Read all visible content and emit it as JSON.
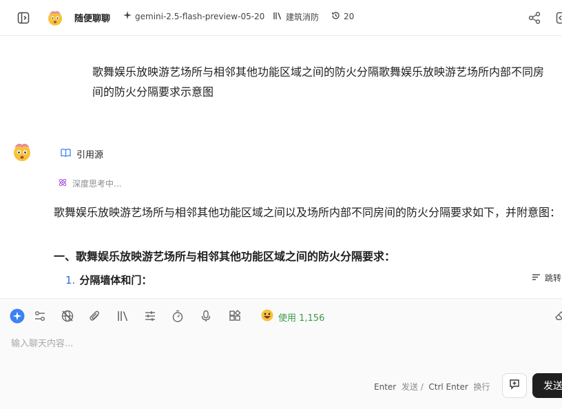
{
  "header": {
    "app_title": "随便聊聊",
    "model": "gemini-2.5-flash-preview-05-20",
    "knowledge_base": "建筑消防",
    "history_count": "20",
    "icons": [
      "sidebar-toggle-icon",
      "sparkle-icon",
      "library-icon",
      "history-icon",
      "share-icon",
      "export-icon"
    ]
  },
  "conversation": {
    "user_message": "歌舞娱乐放映游艺场所与相邻其他功能区域之间的防火分隔歌舞娱乐放映游艺场所内部不同房间的防火分隔要求示意图",
    "assistant": {
      "citation_label": "引用源",
      "thinking_label": "深度思考中...",
      "answer_intro": "歌舞娱乐放映游艺场所与相邻其他功能区域之间以及场所内部不同房间的防火分隔要求如下，并附意图：",
      "section_heading": "一、歌舞娱乐放映游艺场所与相邻其他功能区域之间的防火分隔要求：",
      "list_item_number": "1.",
      "list_item_text": "分隔墙体和门：",
      "jump_label": "跳转"
    }
  },
  "composer": {
    "usage_label": "使用 1,156",
    "placeholder": "输入聊天内容...",
    "hint_enter": "Enter",
    "hint_send": "发送",
    "hint_sep": "/",
    "hint_ctrl_enter": "Ctrl  Enter",
    "hint_newline": "换行",
    "send_label": "发送",
    "tool_icons": [
      "sparkle-mode-icon",
      "settings-sliders-icon",
      "web-off-icon",
      "attachment-icon",
      "library-icon",
      "tune-icon",
      "timer-icon",
      "microphone-icon",
      "apps-icon"
    ]
  },
  "colors": {
    "accent_blue": "#3b82f6",
    "usage_green": "#3a9a4a",
    "send_bg": "#1f1f1f",
    "thinking_purple": "#b05ad8"
  }
}
